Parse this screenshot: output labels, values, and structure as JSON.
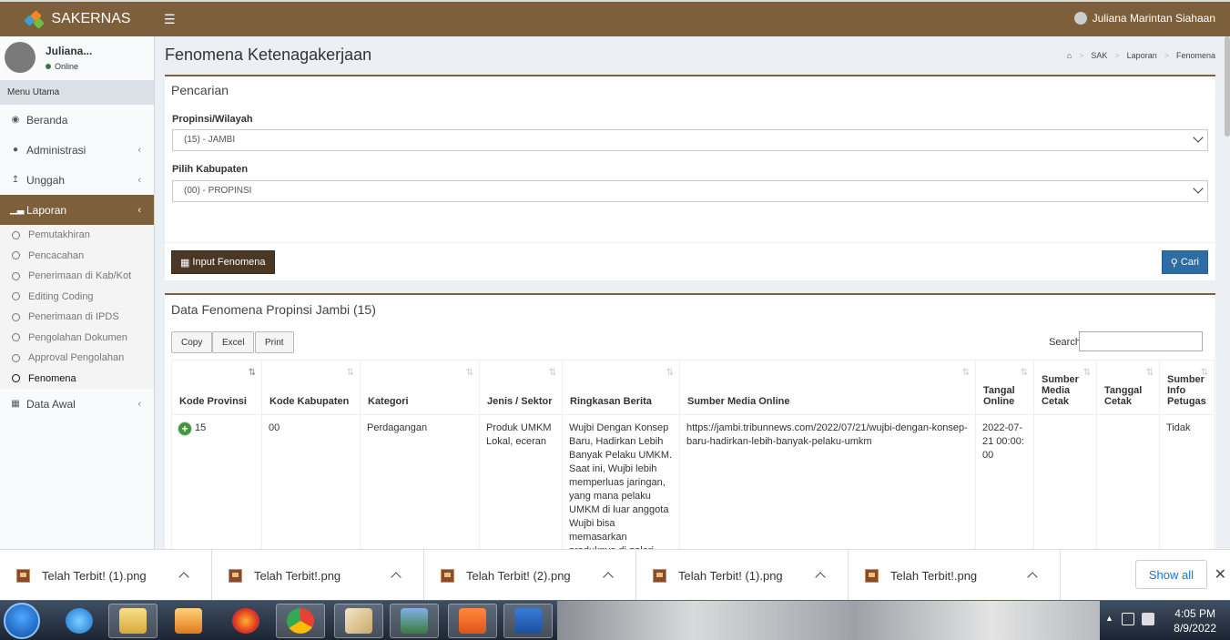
{
  "app": {
    "title": "SAKERNAS",
    "user_name": "Juliana Marintan Siahaan"
  },
  "sidebar": {
    "user_short": "Juliana...",
    "status": "Online",
    "menu_header": "Menu Utama",
    "items": [
      {
        "label": "Beranda",
        "icon": "dashboard-icon"
      },
      {
        "label": "Administrasi",
        "icon": "user-icon"
      },
      {
        "label": "Unggah",
        "icon": "upload-icon"
      },
      {
        "label": "Laporan",
        "icon": "bar-chart-icon"
      }
    ],
    "sub_items": [
      "Pemutakhiran",
      "Pencacahan",
      "Penerimaan di Kab/Kot",
      "Editing Coding",
      "Penerimaan di IPDS",
      "Pengolahan Dokumen",
      "Approval Pengolahan",
      "Fenomena"
    ],
    "last_item": {
      "label": "Data Awal",
      "icon": "table-icon"
    }
  },
  "page": {
    "title": "Fenomena Ketenagakerjaan",
    "breadcrumb": [
      "SAK",
      "Laporan",
      "Fenomena"
    ]
  },
  "search_box": {
    "title": "Pencarian",
    "prov_label": "Propinsi/Wilayah",
    "prov_value": "(15) - JAMBI",
    "kab_label": "Pilih Kabupaten",
    "kab_value": "(00) - PROPINSI",
    "input_button": "Input Fenomena",
    "search_button": "Cari"
  },
  "data_box": {
    "title": "Data Fenomena Propinsi Jambi (15)",
    "buttons": [
      "Copy",
      "Excel",
      "Print"
    ],
    "search_label": "Search:",
    "columns": [
      "Kode Provinsi",
      "Kode Kabupaten",
      "Kategori",
      "Jenis / Sektor",
      "Ringkasan Berita",
      "Sumber Media Online",
      "Tangal Online",
      "Sumber Media Cetak",
      "Tanggal Cetak",
      "Sumber Info Petugas"
    ],
    "rows": [
      [
        "15",
        "00",
        "Perdagangan",
        "Produk UMKM Lokal, eceran",
        "Wujbi Dengan Konsep Baru, Hadirkan Lebih Banyak Pelaku UMKM. Saat ini, Wujbi lebih memperluas jaringan, yang mana pelaku UMKM di luar anggota Wujbi bisa memasarkan produknya di galeri Wujbi yang berlokasi di",
        "https://jambi.tribunnews.com/2022/07/21/wujbi-dengan-konsep-baru-hadirkan-lebih-banyak-pelaku-umkm",
        "2022-07-21 00:00:00",
        "",
        "",
        "Tidak"
      ]
    ]
  },
  "downloads": {
    "items": [
      "Telah Terbit! (1).png",
      "Telah Terbit!.png",
      "Telah Terbit! (2).png",
      "Telah Terbit! (1).png",
      "Telah Terbit!.png"
    ],
    "show_all": "Show all"
  },
  "taskbar": {
    "time": "4:05 PM",
    "date": "8/9/2022"
  }
}
